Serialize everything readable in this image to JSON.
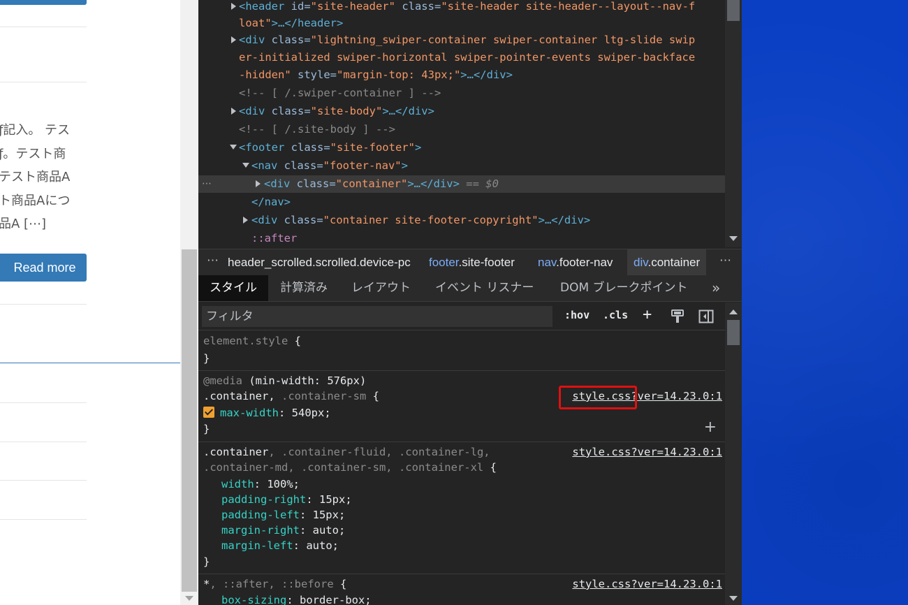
{
  "page": {
    "excerpt_lines": [
      "ƒ記入。 テス",
      "ƒ。テスト商",
      "テスト商品A",
      "ト商品Aにつ",
      "品A [⋯]"
    ],
    "read_more_label": "Read more"
  },
  "elements": {
    "lines": {
      "l1a": "<header",
      "l1b": " id=",
      "l1c": "\"site-header\"",
      "l1d": " class=",
      "l1e": "\"site-header site-header--layout--nav-f",
      "l2a": "loat\"",
      "l2b": ">…</header>",
      "l3a": "<div",
      "l3b": " class=",
      "l3c": "\"lightning_swiper-container swiper-container ltg-slide swip",
      "l4": "er-initialized swiper-horizontal swiper-pointer-events swiper-backface",
      "l5a": "-hidden\"",
      "l5b": " style=",
      "l5c": "\"margin-top: 43px;\"",
      "l5d": ">…</div>",
      "l6": "<!-- [ /.swiper-container ] -->",
      "l7a": "<div",
      "l7b": " class=",
      "l7c": "\"site-body\"",
      "l7d": ">…</div>",
      "l8": "<!-- [ /.site-body ] -->",
      "l9a": "<footer",
      "l9b": " class=",
      "l9c": "\"site-footer\"",
      "l9d": ">",
      "l10a": "<nav",
      "l10b": " class=",
      "l10c": "\"footer-nav\"",
      "l10d": ">",
      "l11a": "<div",
      "l11b": " class=",
      "l11c": "\"container\"",
      "l11d": ">…</div>",
      "l11e": " == ",
      "l11f": "$0",
      "l12": "</nav>",
      "l13a": "<div",
      "l13b": " class=",
      "l13c": "\"container site-footer-copyright\"",
      "l13d": ">…</div>",
      "l14": "::after"
    },
    "row_dots": "⋯"
  },
  "breadcrumb": {
    "more_left": "⋯",
    "item1": "header_scrolled.scrolled.device-pc",
    "item2_tag": "footer",
    "item2_cls": ".site-footer",
    "item3_tag": "nav",
    "item3_cls": ".footer-nav",
    "item4_tag": "div",
    "item4_cls": ".container",
    "more_right": "⋯"
  },
  "tabs": [
    "スタイル",
    "計算済み",
    "レイアウト",
    "イベント リスナー",
    "DOM ブレークポイント"
  ],
  "tabs_overflow": "»",
  "filter": {
    "placeholder": "フィルタ",
    "hov": ":hov",
    "cls": ".cls",
    "add": "+"
  },
  "styles": {
    "element_style": "element.style",
    "open_brace": " {",
    "close_brace": "}",
    "media_kw": "@media",
    "media_query": " (min-width: 576px)",
    "r1_sel_active": ".container",
    "r1_sel_sep": ", ",
    "r1_sel_dim": ".container-sm",
    "r1_src_a": "style.css?",
    "r1_src_b": "ver=14.23.0:1",
    "r1_prop": "max-width",
    "r1_val": ": 540px;",
    "r2_sel_active": ".container",
    "r2_sel_dim1": ", .container-fluid, .container-lg,",
    "r2_sel_dim2": ".container-md, .container-sm, .container-xl",
    "r2_src": "style.css?ver=14.23.0:1",
    "r2_props": [
      {
        "name": "width",
        "value": ": 100%;"
      },
      {
        "name": "padding-right",
        "value": ": 15px;"
      },
      {
        "name": "padding-left",
        "value": ": 15px;"
      },
      {
        "name": "margin-right",
        "value": ": auto;"
      },
      {
        "name": "margin-left",
        "value": ": auto;"
      }
    ],
    "r3_sel_active": "*",
    "r3_sel_dim": ", ::after, ::before",
    "r3_src": "style.css?ver=14.23.0:1",
    "r3_prop": "box-sizing",
    "r3_val": ": border-box;",
    "plus": "+"
  },
  "colors": {
    "highlight_box": "#e01010",
    "accent_blue": "#337ab7",
    "desktop_blue": "#0a3fc4"
  }
}
